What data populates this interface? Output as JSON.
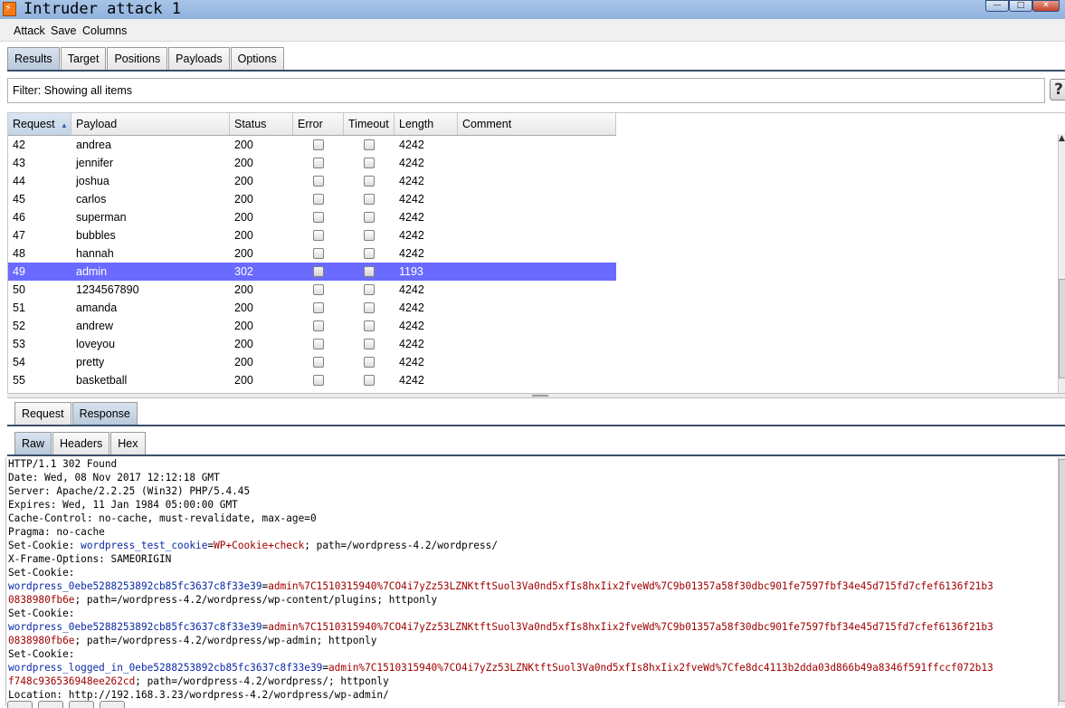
{
  "window": {
    "title": "Intruder attack 1"
  },
  "menu": [
    "Attack",
    "Save",
    "Columns"
  ],
  "main_tabs": [
    {
      "label": "Results",
      "active": true
    },
    {
      "label": "Target",
      "active": false
    },
    {
      "label": "Positions",
      "active": false
    },
    {
      "label": "Payloads",
      "active": false
    },
    {
      "label": "Options",
      "active": false
    }
  ],
  "filter": {
    "text": "Filter: Showing all items",
    "help": "?"
  },
  "table": {
    "columns": [
      "Request",
      "Payload",
      "Status",
      "Error",
      "Timeout",
      "Length",
      "Comment"
    ],
    "sort_indicator": "▲",
    "rows": [
      {
        "request": "42",
        "payload": "andrea",
        "status": "200",
        "length": "4242"
      },
      {
        "request": "43",
        "payload": "jennifer",
        "status": "200",
        "length": "4242"
      },
      {
        "request": "44",
        "payload": "joshua",
        "status": "200",
        "length": "4242"
      },
      {
        "request": "45",
        "payload": "carlos",
        "status": "200",
        "length": "4242"
      },
      {
        "request": "46",
        "payload": "superman",
        "status": "200",
        "length": "4242"
      },
      {
        "request": "47",
        "payload": "bubbles",
        "status": "200",
        "length": "4242"
      },
      {
        "request": "48",
        "payload": "hannah",
        "status": "200",
        "length": "4242"
      },
      {
        "request": "49",
        "payload": "admin",
        "status": "302",
        "length": "1193",
        "selected": true
      },
      {
        "request": "50",
        "payload": "1234567890",
        "status": "200",
        "length": "4242"
      },
      {
        "request": "51",
        "payload": "amanda",
        "status": "200",
        "length": "4242"
      },
      {
        "request": "52",
        "payload": "andrew",
        "status": "200",
        "length": "4242"
      },
      {
        "request": "53",
        "payload": "loveyou",
        "status": "200",
        "length": "4242"
      },
      {
        "request": "54",
        "payload": "pretty",
        "status": "200",
        "length": "4242"
      },
      {
        "request": "55",
        "payload": "basketball",
        "status": "200",
        "length": "4242"
      }
    ]
  },
  "message_tabs": [
    {
      "label": "Request",
      "active": false
    },
    {
      "label": "Response",
      "active": true
    }
  ],
  "view_tabs": [
    {
      "label": "Raw",
      "active": true
    },
    {
      "label": "Headers",
      "active": false
    },
    {
      "label": "Hex",
      "active": false
    }
  ],
  "response": {
    "status_line": "HTTP/1.1 302 Found",
    "date": "Date: Wed, 08 Nov 2017 12:12:18 GMT",
    "server": "Server: Apache/2.2.25 (Win32) PHP/5.4.45",
    "expires": "Expires: Wed, 11 Jan 1984 05:00:00 GMT",
    "cache_control": "Cache-Control: no-cache, must-revalidate, max-age=0",
    "pragma": "Pragma: no-cache",
    "cookie1_prefix": "Set-Cookie: ",
    "cookie1_name": "wordpress_test_cookie",
    "cookie1_eq": "=",
    "cookie1_value": "WP+Cookie+check",
    "cookie1_rest": "; path=/wordpress-4.2/wordpress/",
    "xfo": "X-Frame-Options: SAMEORIGIN",
    "set_cookie": "Set-Cookie:",
    "cookie2_name": "wordpress_0ebe5288253892cb85fc3637c8f33e39",
    "cookie2_eq": "=",
    "cookie2_value": "admin%7C1510315940%7CO4i7yZz53LZNKtftSuol3Va0nd5xfIs8hxIix2fveWd%7C9b01357a58f30dbc901fe7597fbf34e45d715fd7cfef6136f21b3",
    "cookie2_value2": "0838980fb6e",
    "cookie2_rest": "; path=/wordpress-4.2/wordpress/wp-content/plugins; httponly",
    "cookie3_name": "wordpress_0ebe5288253892cb85fc3637c8f33e39",
    "cookie3_eq": "=",
    "cookie3_value": "admin%7C1510315940%7CO4i7yZz53LZNKtftSuol3Va0nd5xfIs8hxIix2fveWd%7C9b01357a58f30dbc901fe7597fbf34e45d715fd7cfef6136f21b3",
    "cookie3_value2": "0838980fb6e",
    "cookie3_rest": "; path=/wordpress-4.2/wordpress/wp-admin; httponly",
    "cookie4_name": "wordpress_logged_in_0ebe5288253892cb85fc3637c8f33e39",
    "cookie4_eq": "=",
    "cookie4_value": "admin%7C1510315940%7CO4i7yZz53LZNKtftSuol3Va0nd5xfIs8hxIix2fveWd%7Cfe8dc4113b2dda03d866b49a8346f591ffccf072b13",
    "cookie4_value2": "f748c936536948ee262cd",
    "cookie4_rest": "; path=/wordpress-4.2/wordpress/; httponly",
    "location": "Location: http://192.168.3.23/wordpress-4.2/wordpress/wp-admin/"
  },
  "colors": {
    "selected_row": "#6a6aff",
    "cookie_name": "#0a2aa8",
    "cookie_value": "#a00000"
  }
}
